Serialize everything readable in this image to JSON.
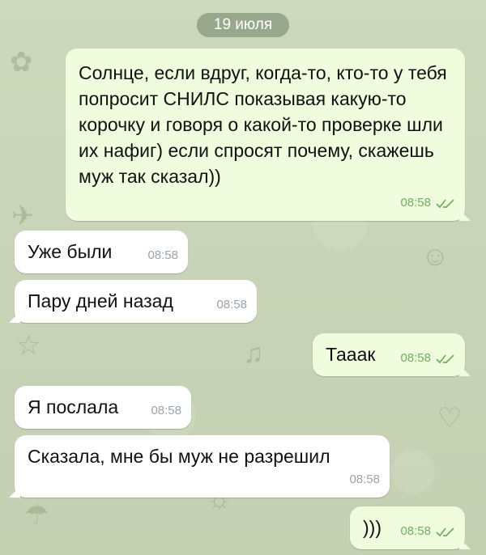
{
  "date_separator": "19 июля",
  "colors": {
    "outgoing_bubble": "#effdde",
    "incoming_bubble": "#ffffff",
    "read_check": "#6fb05f",
    "time_incoming": "#9aa3a9",
    "background": "#c9d5b9"
  },
  "messages": [
    {
      "direction": "outgoing",
      "text": "Солнце, если вдруг, когда-то, кто-то у тебя попросит СНИЛС показывая какую-то корочку и говоря о какой-то проверке шли их нафиг) если спросят почему, скажешь муж так сказал))",
      "time": "08:58",
      "status": "read-double-check-icon"
    },
    {
      "direction": "incoming",
      "text": "Уже были",
      "time": "08:58"
    },
    {
      "direction": "incoming",
      "text": "Пару дней назад",
      "time": "08:58"
    },
    {
      "direction": "outgoing",
      "text": "Тааак",
      "time": "08:58",
      "status": "read-double-check-icon"
    },
    {
      "direction": "incoming",
      "text": "Я послала",
      "time": "08:58"
    },
    {
      "direction": "incoming",
      "text": "Сказала, мне бы муж не разрешил",
      "time": "08:58"
    },
    {
      "direction": "outgoing",
      "text": ")))",
      "time": "08:58",
      "status": "read-double-check-icon"
    }
  ]
}
